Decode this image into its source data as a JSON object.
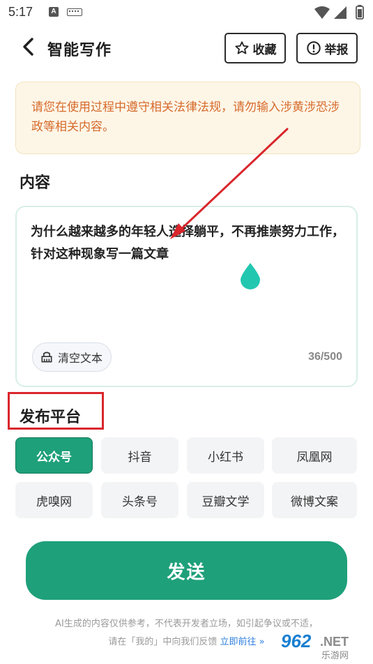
{
  "status_bar": {
    "time": "5:17",
    "a_badge": "A"
  },
  "header": {
    "title": "智能写作",
    "favorite_label": "收藏",
    "report_label": "举报"
  },
  "notice": {
    "text": "请您在使用过程中遵守相关法律法规，请勿输入涉黄涉恐涉政等相关内容。"
  },
  "content": {
    "section_title": "内容",
    "text": "为什么越来越多的年轻人选择躺平，不再推崇努力工作，针对这种现象写一篇文章",
    "clear_label": "清空文本",
    "counter": "36/500"
  },
  "platform": {
    "section_title": "发布平台",
    "options": [
      "公众号",
      "抖音",
      "小红书",
      "凤凰网",
      "虎嗅网",
      "头条号",
      "豆瓣文学",
      "微博文案"
    ],
    "selected": "公众号"
  },
  "send": {
    "label": "发送"
  },
  "footer": {
    "line1": "AI生成的内容仅供参考，不代表开发者立场，如引起争议或不适，",
    "line2_prefix": "请在「我的」中向我们反馈",
    "link": "立即前往 »"
  },
  "watermark": {
    "main": "962",
    "suffix": ".NET",
    "sub": "乐游网"
  },
  "colors": {
    "accent": "#1ea07a",
    "notice_text": "#d66a2c",
    "notice_bg": "#fdf6e7",
    "annotation": "#d9262c",
    "link": "#2f7fe0"
  }
}
